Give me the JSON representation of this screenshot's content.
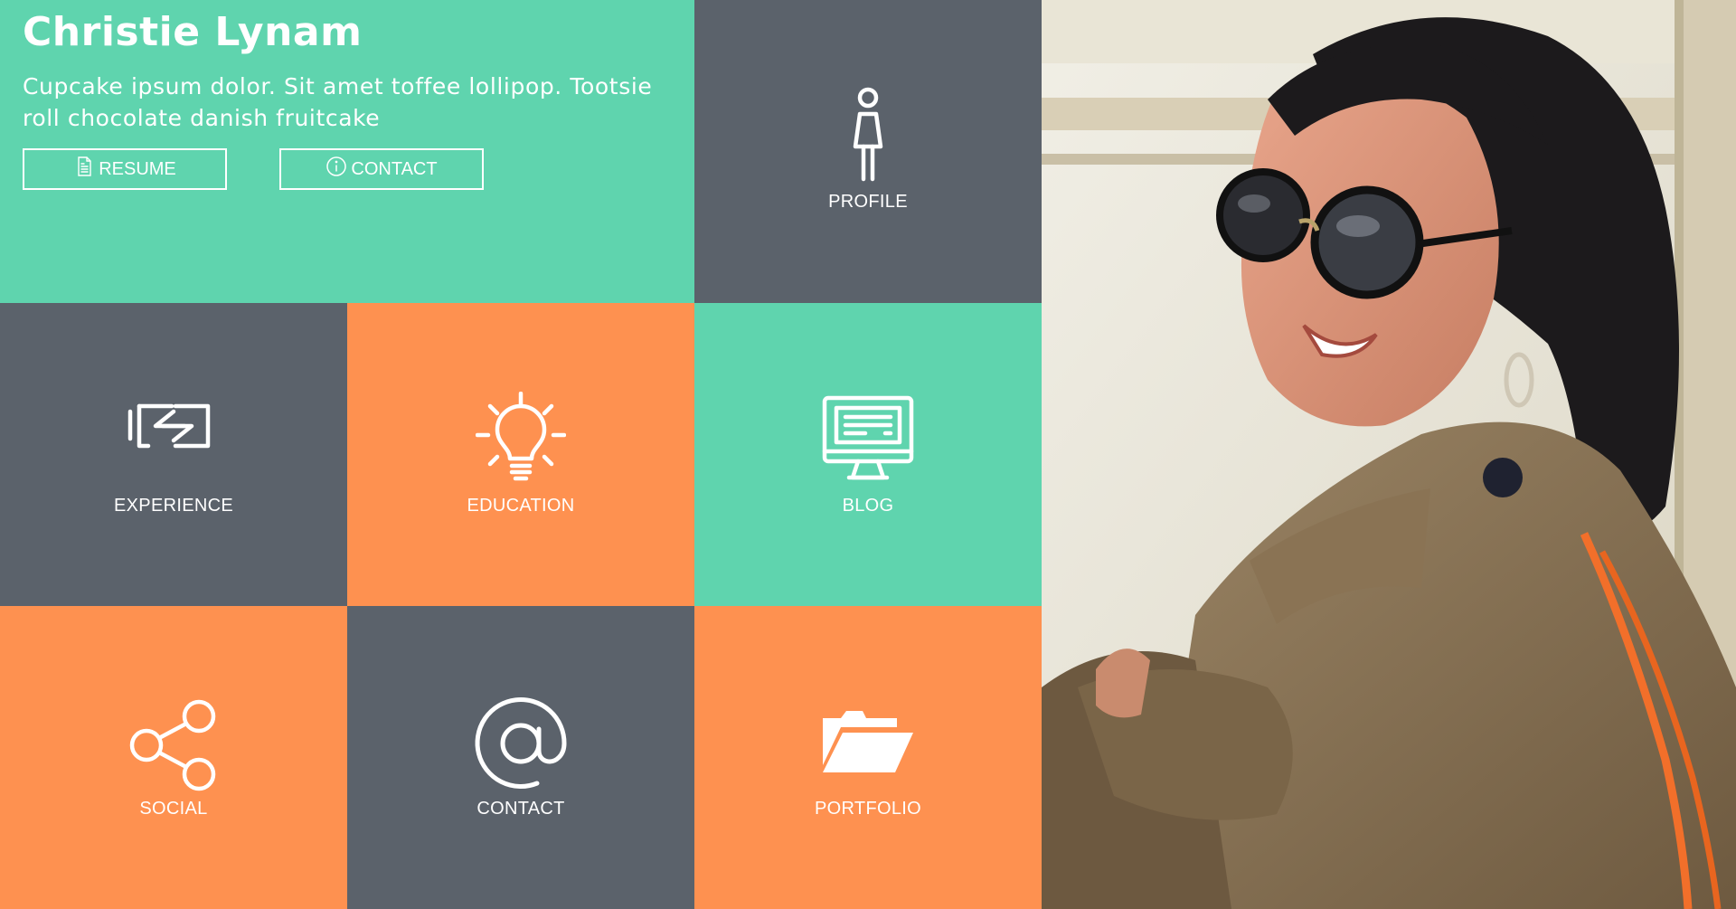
{
  "hero": {
    "name": "Christie Lynam",
    "tagline": "Cupcake ipsum dolor. Sit amet toffee lollipop. Tootsie roll chocolate danish fruitcake",
    "buttons": {
      "resume": {
        "label": "RESUME",
        "icon": "document-icon"
      },
      "contact": {
        "label": "CONTACT",
        "icon": "info-icon"
      }
    }
  },
  "tiles": {
    "profile": {
      "label": "PROFILE",
      "icon": "person-icon"
    },
    "experience": {
      "label": "EXPERIENCE",
      "icon": "exchange-icon"
    },
    "education": {
      "label": "EDUCATION",
      "icon": "lightbulb-icon"
    },
    "blog": {
      "label": "BLOG",
      "icon": "monitor-icon"
    },
    "social": {
      "label": "SOCIAL",
      "icon": "share-icon"
    },
    "contact": {
      "label": "CONTACT",
      "icon": "at-sign-icon"
    },
    "portfolio": {
      "label": "PORTFOLIO",
      "icon": "folder-icon"
    }
  },
  "colors": {
    "teal": "#5fd4ae",
    "slate": "#5b626b",
    "orange": "#fe9150",
    "text": "#ffffff"
  }
}
